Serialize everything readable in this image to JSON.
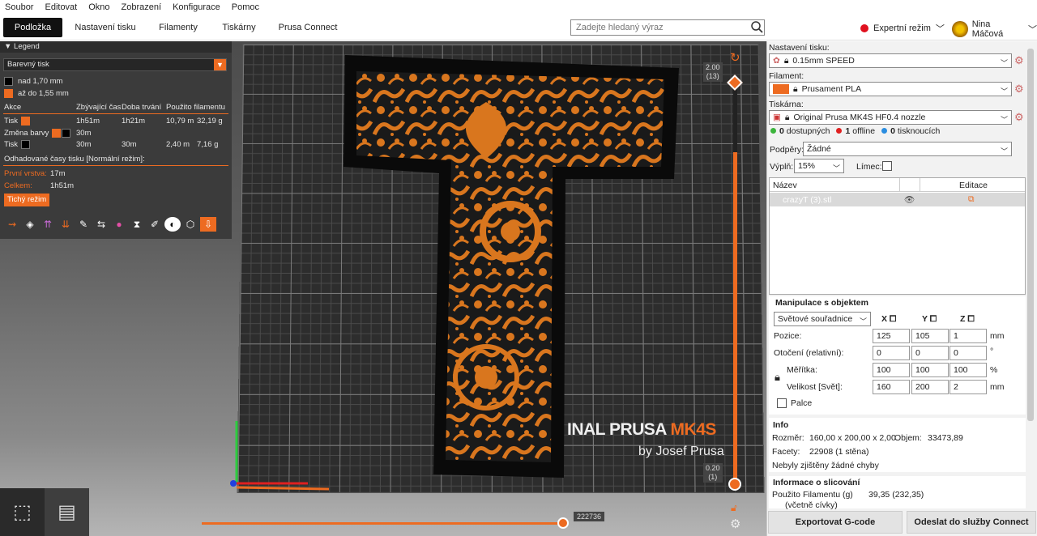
{
  "menu": [
    "Soubor",
    "Editovat",
    "Okno",
    "Zobrazení",
    "Konfigurace",
    "Pomoc"
  ],
  "tabs": [
    "Podložka",
    "Nastavení tisku",
    "Filamenty",
    "Tiskárny",
    "Prusa Connect"
  ],
  "search": {
    "placeholder": "Zadejte hledaný výraz"
  },
  "mode_label": "Expertní režim",
  "user_name": "Nina Máčová",
  "legend": {
    "title": "Legend",
    "view_type": "Barevný tisk",
    "ranges": [
      "nad 1,70 mm",
      "až do 1,55 mm"
    ],
    "table_headers": [
      "Akce",
      "Zbývající čas",
      "Doba trvání",
      "Použito filamentu"
    ],
    "rows": [
      {
        "action": "Tisk",
        "color": "orange",
        "remaining": "1h51m",
        "duration": "1h21m",
        "length": "10,79 m",
        "weight": "32,19 g"
      },
      {
        "action": "Změna barvy",
        "color": "orange-black",
        "remaining": "30m",
        "duration": "",
        "length": "",
        "weight": ""
      },
      {
        "action": "Tisk",
        "color": "black",
        "remaining": "30m",
        "duration": "30m",
        "length": "2,40 m",
        "weight": "7,16 g"
      }
    ],
    "estimate_title": "Odhadované časy tisku [Normální režim]:",
    "first_layer_label": "První vrstva:",
    "first_layer_value": "17m",
    "total_label": "Celkem:",
    "total_value": "1h51m",
    "quiet_mode": "Tichý režim",
    "icons": [
      "legend-travel-icon",
      "legend-wipe-icon",
      "legend-retract-icon",
      "legend-deretract-icon",
      "legend-seam-icon",
      "legend-toolchange-icon",
      "legend-colorchange-icon",
      "legend-pause-icon",
      "legend-custom-gcode-icon",
      "legend-center-of-gravity-icon",
      "legend-shells-icon",
      "legend-tool-marker-icon"
    ]
  },
  "bed_label": {
    "brand": "INAL PRUSA",
    "model": "MK4S",
    "byline": "by Josef Prusa"
  },
  "layer_slider": {
    "top_height": "2.00",
    "top_layer": "(13)",
    "bottom_height": "0.20",
    "bottom_layer": "(1)"
  },
  "move_slider": {
    "value": "222736"
  },
  "right": {
    "print_settings_label": "Nastavení tisku:",
    "print_settings_value": "0.15mm SPEED",
    "filament_label": "Filament:",
    "filament_value": "Prusament PLA",
    "filament_color": "#ed6b21",
    "printer_label": "Tiskárna:",
    "printer_value": "Original Prusa MK4S HF0.4 nozzle",
    "status": [
      {
        "count": "0",
        "label": "dostupných",
        "color": "#3cb43c"
      },
      {
        "count": "1",
        "label": "offline",
        "color": "#e02020"
      },
      {
        "count": "0",
        "label": "tisknoucích",
        "color": "#2a8de0"
      }
    ],
    "supports_label": "Podpěry:",
    "supports_value": "Žádné",
    "infill_label": "Výplň:",
    "infill_value": "15%",
    "brim_label": "Límec:",
    "list_headers": {
      "name": "Název",
      "edit": "Editace"
    },
    "object_name": "crazyT (3).stl",
    "manip_title": "Manipulace s objektem",
    "coord_system": "Světové souřadnice",
    "axes": [
      "X",
      "Y",
      "Z"
    ],
    "position_label": "Pozice:",
    "position": [
      "125",
      "105",
      "1"
    ],
    "position_unit": "mm",
    "rotation_label": "Otočení (relativní):",
    "rotation": [
      "0",
      "0",
      "0"
    ],
    "rotation_unit": "°",
    "scale_label": "Měřítka:",
    "scale": [
      "100",
      "100",
      "100"
    ],
    "scale_unit": "%",
    "size_label": "Velikost [Svět]:",
    "size": [
      "160",
      "200",
      "2"
    ],
    "size_unit": "mm",
    "inches_label": "Palce",
    "info_title": "Info",
    "dim_label": "Rozměr:",
    "dim_value": "160,00 x 200,00 x 2,00",
    "volume_label": "Objem:",
    "volume_value": "33473,89",
    "facets_label": "Facety:",
    "facets_value": "22908 (1 stěna)",
    "errors": "Nebyly zjištěny žádné chyby",
    "slice_title": "Informace o slicování",
    "filament_used_label": "Použito Filamentu (g)",
    "filament_used_value": "39,35 (232,35)",
    "filament_used_sub": "(včetně cívky)",
    "export_btn": "Exportovat G-code",
    "send_btn": "Odeslat do služby Connect"
  }
}
